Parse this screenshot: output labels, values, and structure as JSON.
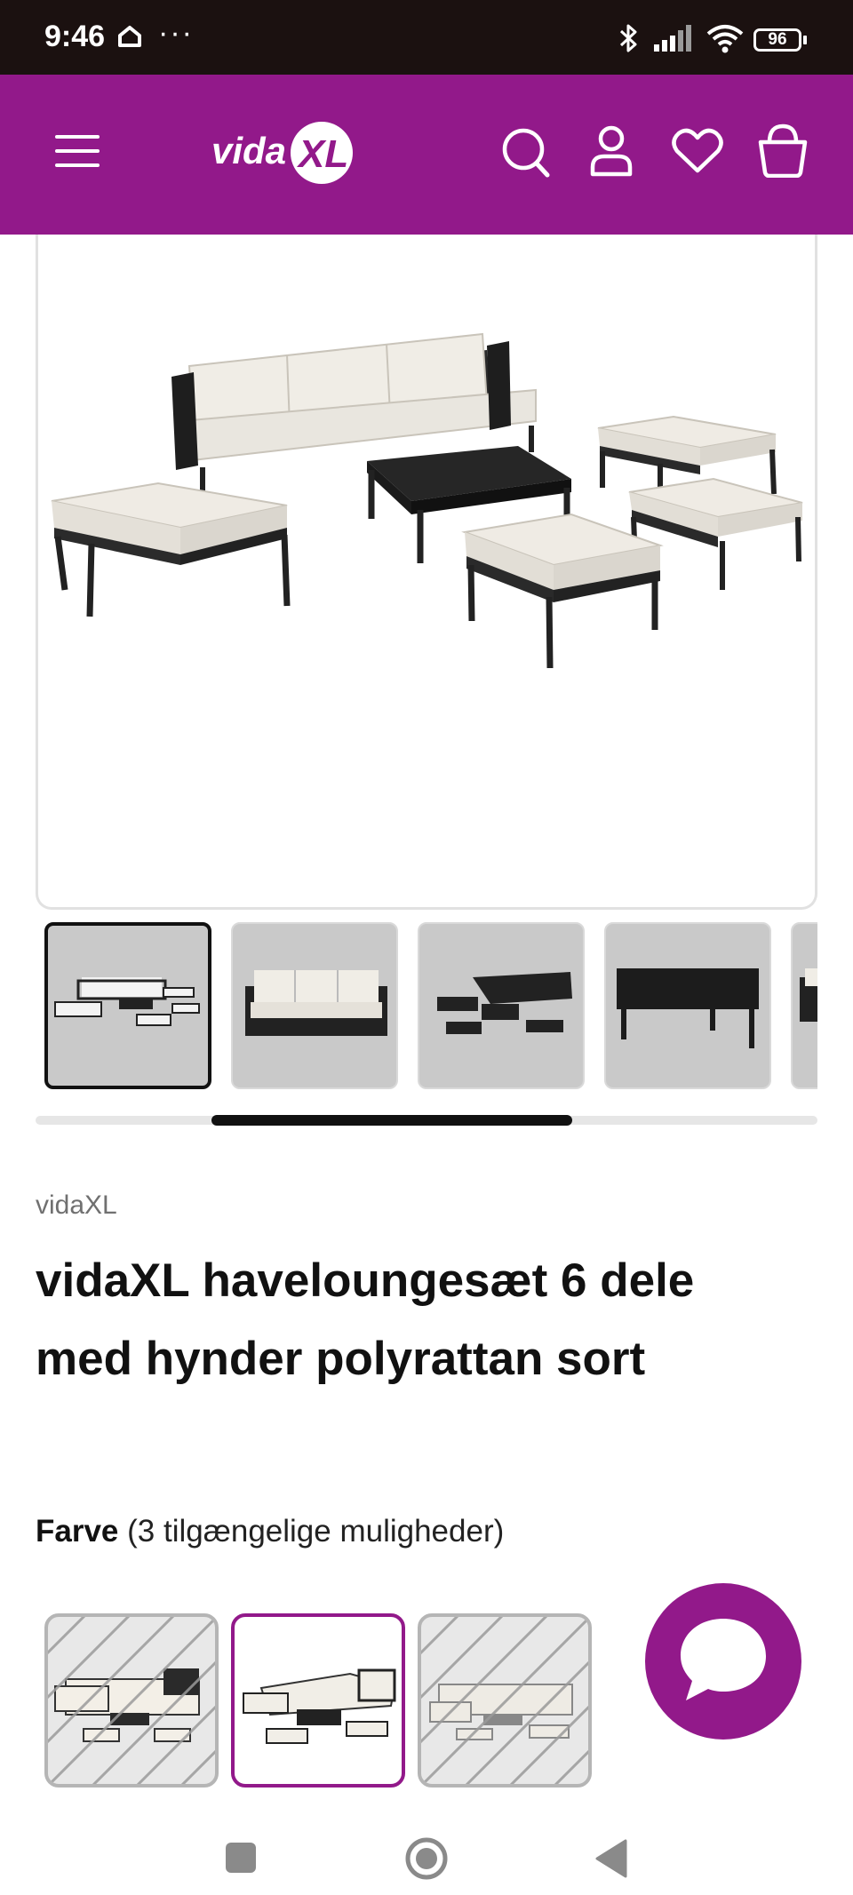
{
  "status_bar": {
    "time": "9:46",
    "more": "···",
    "battery": "96"
  },
  "header": {
    "logo_text": "vidaXL",
    "icons": [
      "menu-icon",
      "search-icon",
      "account-icon",
      "heart-icon",
      "cart-icon"
    ],
    "background": "#92198a"
  },
  "gallery": {
    "thumbnail_count_visible": 5,
    "active_index": 0
  },
  "product": {
    "brand": "vidaXL",
    "title_line1": "vidaXL haveloungesæt 6 dele",
    "title_line2": "med hynder polyrattan sort"
  },
  "color_option": {
    "label": "Farve",
    "count_text": "(3 tilgængelige muligheder)",
    "selected_index": 1,
    "accent": "#92198a"
  },
  "nav": {
    "icons": [
      "recents-icon",
      "home-icon",
      "back-icon"
    ]
  }
}
